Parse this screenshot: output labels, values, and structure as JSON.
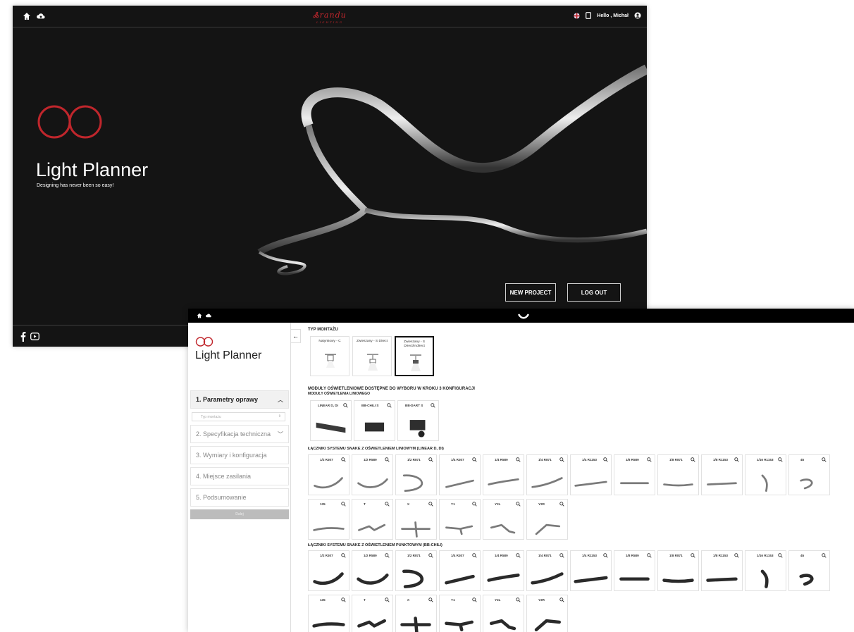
{
  "home": {
    "user_greeting": "Hello , Michał",
    "hero_title": "Light Planner",
    "hero_subtitle": "Designing has never been so easy!",
    "new_project_label": "NEW PROJECT",
    "logout_label": "LOG OUT",
    "accent": "#c0262c"
  },
  "planner": {
    "app_title": "Light Planner",
    "steps": [
      {
        "label": "1. Parametry oprawy",
        "active": true
      },
      {
        "label": "2. Specyfikacja techniczna"
      },
      {
        "label": "3. Wymiary i konfiguracja"
      },
      {
        "label": "4. Miejsce zasilania"
      },
      {
        "label": "5. Podsumowanie"
      }
    ],
    "typ_placeholder": "Typ montażu",
    "next_label": "Dalej",
    "mount_title": "TYP MONTAŻU",
    "mounts": [
      "Natynkowy - C",
      "Zwieszany - S Direct",
      "Zwieszany - S Direct/Indirect"
    ],
    "modules_title": "MODUŁY OŚWIETLENIOWE DOSTĘPNE DO WYBORU W KROKU 3 KONFIGURACJI",
    "modules_subtitle": "MODUŁY OŚWIETLENIA LINIOWEGO",
    "modules": [
      "LINEAR D, DI",
      "BB-CHILI S",
      "BB-DART S"
    ],
    "linear_title": "ŁĄCZNIKI SYSTEMU SNAKE Z OŚWIETLENIEM LINIOWYM (LINEAR D, DI)",
    "point_title": "ŁĄCZNIKI SYSTEMU SNAKE Z OŚWIETLENIEM PUNKTOWYM (BB-CHILI)",
    "connectors_row1": [
      "1/2 R307",
      "1/2 R589",
      "1/2 R871",
      "1/4 R307",
      "1/4 R589",
      "1/4 R871",
      "1/4 R1153",
      "1/8 R589",
      "1/8 R871",
      "1/8 R1153",
      "1/16 R1153",
      "45"
    ],
    "connectors_row2": [
      "135",
      "T",
      "X",
      "Y1",
      "Y2L",
      "Y2R"
    ]
  }
}
